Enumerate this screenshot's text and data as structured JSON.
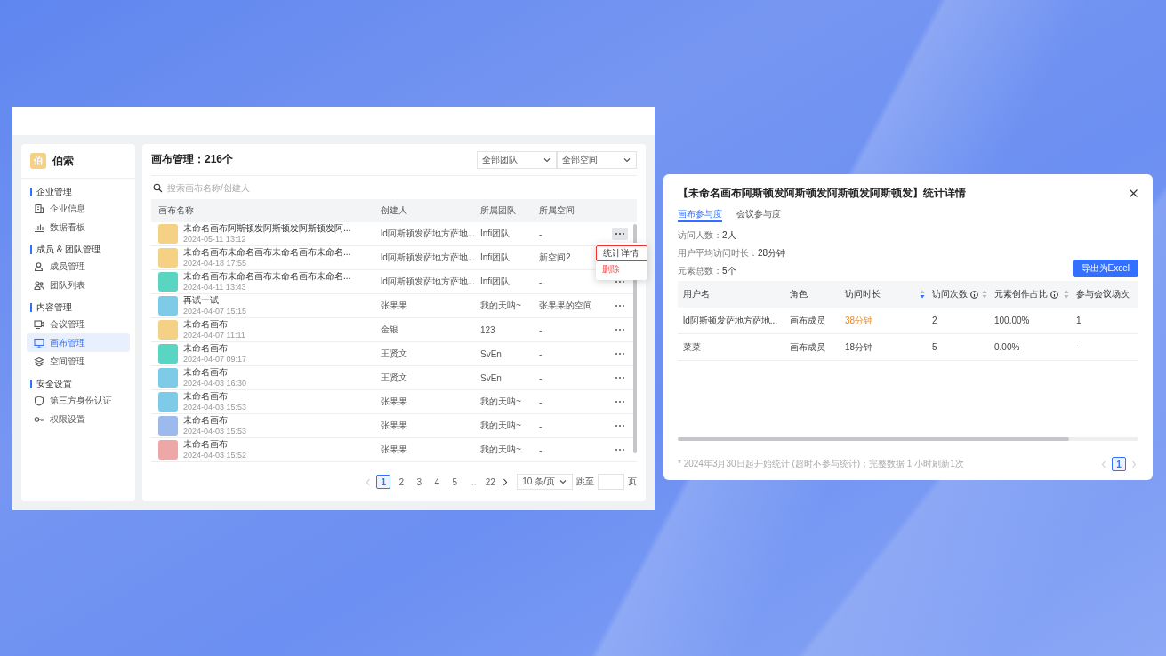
{
  "sidebar": {
    "logo": "伯",
    "brand": "伯索",
    "groups": [
      {
        "title": "企业管理",
        "items": [
          {
            "label": "企业信息",
            "selected": false
          },
          {
            "label": "数据看板",
            "selected": false
          }
        ]
      },
      {
        "title": "成员 & 团队管理",
        "items": [
          {
            "label": "成员管理",
            "selected": false
          },
          {
            "label": "团队列表",
            "selected": false
          }
        ]
      },
      {
        "title": "内容管理",
        "items": [
          {
            "label": "会议管理",
            "selected": false
          },
          {
            "label": "画布管理",
            "selected": true
          },
          {
            "label": "空间管理",
            "selected": false
          }
        ]
      },
      {
        "title": "安全设置",
        "items": [
          {
            "label": "第三方身份认证",
            "selected": false
          },
          {
            "label": "权限设置",
            "selected": false
          }
        ]
      }
    ]
  },
  "canvas_list": {
    "title": "画布管理：216个",
    "filters": [
      "全部团队",
      "全部空间"
    ],
    "search": {
      "placeholder": "搜索画布名称/创建人"
    },
    "columns": [
      "画布名称",
      "创建人",
      "所属团队",
      "所属空间"
    ],
    "rows": [
      {
        "name": "未命名画布阿斯顿发阿斯顿发阿斯顿发阿...",
        "date": "2024-05-11 13:12",
        "color": "#f5d185",
        "creator": "ld阿斯顿发萨地方萨地...",
        "team": "Infi团队",
        "space": "-",
        "menu_open": true,
        "more_hidden": false
      },
      {
        "name": "未命名画布未命名画布未命名画布未命名...",
        "date": "2024-04-18 17:55",
        "color": "#f5d185",
        "creator": "ld阿斯顿发萨地方萨地...",
        "team": "Infi团队",
        "space": "新空间2",
        "menu_open": false,
        "more_hidden": true
      },
      {
        "name": "未命名画布未命名画布未命名画布未命名...",
        "date": "2024-04-11 13:43",
        "color": "#5ad5c2",
        "creator": "ld阿斯顿发萨地方萨地...",
        "team": "Infi团队",
        "space": "-",
        "menu_open": false,
        "more_hidden": false
      },
      {
        "name": "再试一试",
        "date": "2024-04-07 15:15",
        "color": "#7ecbe8",
        "creator": "张果果",
        "team": "我的天呐~",
        "space": "张果果的空间",
        "menu_open": false,
        "more_hidden": false
      },
      {
        "name": "未命名画布",
        "date": "2024-04-07 11:11",
        "color": "#f5d185",
        "creator": "金银",
        "team": "123",
        "space": "-",
        "menu_open": false,
        "more_hidden": false
      },
      {
        "name": "未命名画布",
        "date": "2024-04-07 09:17",
        "color": "#5ad5c2",
        "creator": "王贤文",
        "team": "SvEn",
        "space": "-",
        "menu_open": false,
        "more_hidden": false
      },
      {
        "name": "未命名画布",
        "date": "2024-04-03 16:30",
        "color": "#7ecbe8",
        "creator": "王贤文",
        "team": "SvEn",
        "space": "-",
        "menu_open": false,
        "more_hidden": false
      },
      {
        "name": "未命名画布",
        "date": "2024-04-03 15:53",
        "color": "#7ecbe8",
        "creator": "张果果",
        "team": "我的天呐~",
        "space": "-",
        "menu_open": false,
        "more_hidden": false
      },
      {
        "name": "未命名画布",
        "date": "2024-04-03 15:53",
        "color": "#9dbaef",
        "creator": "张果果",
        "team": "我的天呐~",
        "space": "-",
        "menu_open": false,
        "more_hidden": false
      },
      {
        "name": "未命名画布",
        "date": "2024-04-03 15:52",
        "color": "#eda7a7",
        "creator": "张果果",
        "team": "我的天呐~",
        "space": "-",
        "menu_open": false,
        "more_hidden": false
      }
    ],
    "row_menu": {
      "items": [
        {
          "label": "统计详情",
          "outlined": true,
          "danger": false
        },
        {
          "label": "删除",
          "outlined": false,
          "danger": true
        }
      ]
    },
    "pagination": {
      "prev_disabled": true,
      "next_disabled": false,
      "pages": [
        {
          "label": "1",
          "kind": "page",
          "selected": true
        },
        {
          "label": "2",
          "kind": "page",
          "selected": false
        },
        {
          "label": "3",
          "kind": "page",
          "selected": false
        },
        {
          "label": "4",
          "kind": "page",
          "selected": false
        },
        {
          "label": "5",
          "kind": "page",
          "selected": false
        },
        {
          "label": "...",
          "kind": "ellipsis"
        },
        {
          "label": "22",
          "kind": "page",
          "selected": false
        }
      ],
      "page_size": "10 条/页",
      "jump_label": "跳至",
      "page_unit": "页"
    }
  },
  "stats_dialog": {
    "title": "【未命名画布阿斯顿发阿斯顿发阿斯顿发阿斯顿发】统计详情",
    "tabs": [
      {
        "label": "画布参与度",
        "selected": true
      },
      {
        "label": "会议参与度",
        "selected": false
      }
    ],
    "stats": [
      {
        "label": "访问人数：",
        "value": "2人"
      },
      {
        "label": "用户平均访问时长：",
        "value": "28分钟"
      },
      {
        "label": "元素总数：",
        "value": "5个"
      }
    ],
    "export_button": "导出为Excel",
    "columns": [
      {
        "label": "用户名"
      },
      {
        "label": "角色"
      },
      {
        "label": "访问时长",
        "sortable": true,
        "sorted_desc": true
      },
      {
        "label": "访问次数",
        "info": true,
        "sortable": true,
        "sorted_desc": false
      },
      {
        "label": "元素创作占比",
        "info": true,
        "sortable": true,
        "sorted_desc": false
      },
      {
        "label": "参与会议场次"
      }
    ],
    "rows": [
      {
        "cells": [
          "ld阿斯顿发萨地方萨地...",
          "画布成员",
          "38分钟",
          "2",
          "100.00%",
          "1"
        ],
        "duration_alert": true
      },
      {
        "cells": [
          "菜菜",
          "画布成员",
          "18分钟",
          "5",
          "0.00%",
          "-"
        ],
        "duration_alert": false
      }
    ],
    "note": "* 2024年3月30日起开始统计 (超时不参与统计)；完整数据 1 小时刷新1次",
    "pagination": {
      "prev_disabled": true,
      "next_disabled": true,
      "pages": [
        {
          "label": "1",
          "kind": "page",
          "selected": true
        }
      ]
    }
  }
}
